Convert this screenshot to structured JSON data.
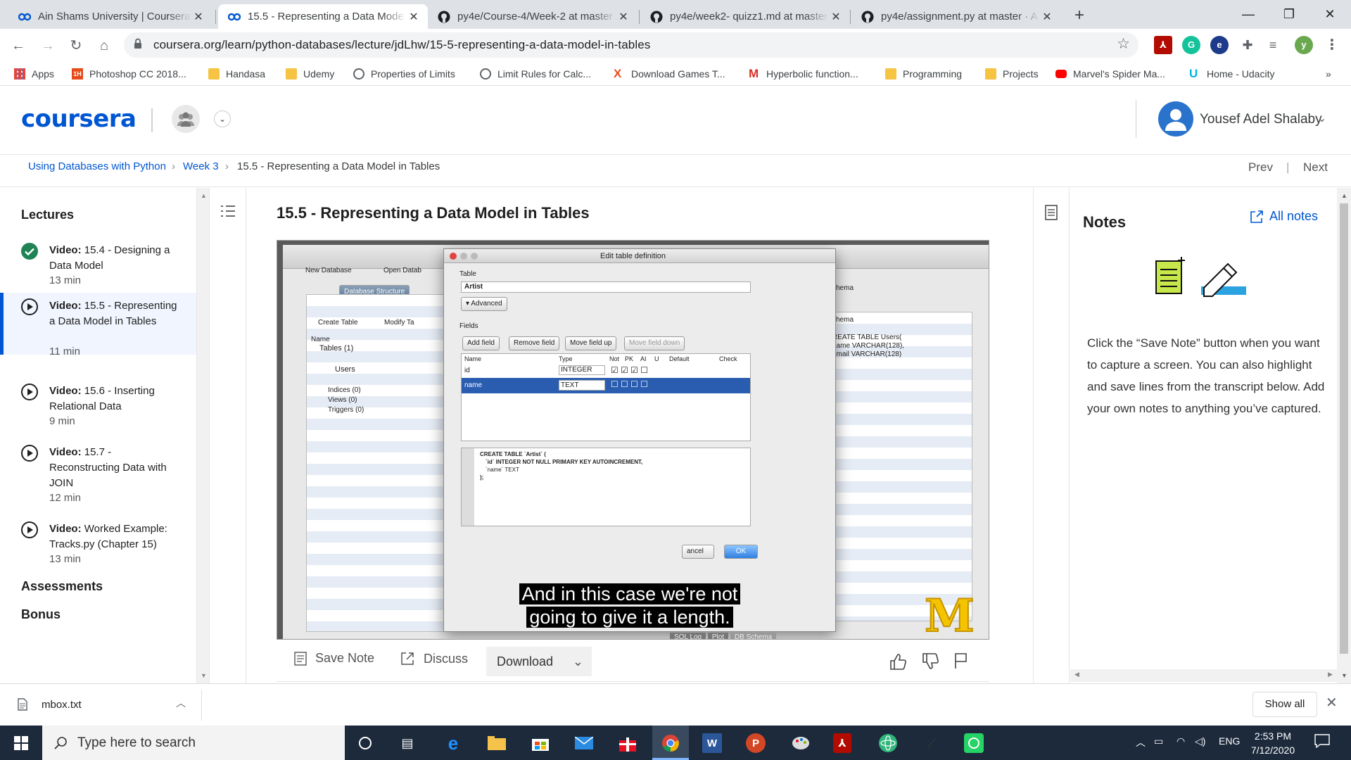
{
  "browser": {
    "tabs": [
      {
        "title": "Ain Shams University | Coursera",
        "favicon": "coursera-icon"
      },
      {
        "title": "15.5 - Representing a Data Mode",
        "favicon": "coursera-icon",
        "active": true
      },
      {
        "title": "py4e/Course-4/Week-2 at master",
        "favicon": "github-icon"
      },
      {
        "title": "py4e/week2- quizz1.md at master",
        "favicon": "github-icon"
      },
      {
        "title": "py4e/assignment.py at master · A",
        "favicon": "github-icon"
      }
    ],
    "url": "coursera.org/learn/python-databases/lecture/jdLhw/15-5-representing-a-data-model-in-tables",
    "profile_initial": "y",
    "bookmarks": [
      {
        "label": "Apps",
        "icon": "apps-grid-icon"
      },
      {
        "label": "Photoshop CC 2018...",
        "icon": "ih-icon"
      },
      {
        "label": "Handasa",
        "icon": "folder-icon"
      },
      {
        "label": "Udemy",
        "icon": "folder-icon"
      },
      {
        "label": "Properties of Limits",
        "icon": "globe-icon"
      },
      {
        "label": "Limit Rules for Calc...",
        "icon": "globe-icon"
      },
      {
        "label": "Download Games T...",
        "icon": "x-icon"
      },
      {
        "label": "Hyperbolic function...",
        "icon": "gmail-icon"
      },
      {
        "label": "Programming",
        "icon": "folder-icon"
      },
      {
        "label": "Projects",
        "icon": "folder-icon"
      },
      {
        "label": "Marvel's Spider Ma...",
        "icon": "youtube-icon"
      },
      {
        "label": "Home - Udacity",
        "icon": "udacity-icon"
      }
    ]
  },
  "header": {
    "logo": "coursera",
    "username": "Yousef Adel Shalaby"
  },
  "breadcrumb": {
    "items": [
      "Using Databases with Python",
      "Week 3",
      "15.5 - Representing a Data Model in Tables"
    ],
    "prev": "Prev",
    "next": "Next"
  },
  "sidebar": {
    "lectures_heading": "Lectures",
    "lectures": [
      {
        "kind": "Video:",
        "title": "15.4 - Designing a Data Model",
        "duration": "13 min",
        "status": "done"
      },
      {
        "kind": "Video:",
        "title": "15.5 - Representing a Data Model in Tables",
        "duration": "11 min",
        "status": "active"
      },
      {
        "kind": "Video:",
        "title": "15.6 - Inserting Relational Data",
        "duration": "9 min",
        "status": "todo"
      },
      {
        "kind": "Video:",
        "title": "15.7 - Reconstructing Data with JOIN",
        "duration": "12 min",
        "status": "todo"
      },
      {
        "kind": "Video:",
        "title": "Worked Example: Tracks.py (Chapter 15)",
        "duration": "13 min",
        "status": "todo"
      }
    ],
    "assessments": "Assessments",
    "bonus": "Bonus"
  },
  "main": {
    "title": "15.5 - Representing a Data Model in Tables",
    "video": {
      "dialog_title": "Edit table definition",
      "table_label": "Table",
      "table_name": "Artist",
      "advanced": "Advanced",
      "fields_label": "Fields",
      "buttons": [
        "Add field",
        "Remove field",
        "Move field up",
        "Move field down"
      ],
      "columns": [
        "Name",
        "Type",
        "Not",
        "PK",
        "AI",
        "U",
        "Default",
        "Check"
      ],
      "rows": [
        {
          "name": "id",
          "type": "INTEGER"
        },
        {
          "name": "name",
          "type": "TEXT"
        }
      ],
      "sql_lines": [
        "CREATE TABLE `Artist` (",
        "`id`   INTEGER NOT NULL PRIMARY KEY AUTOINCREMENT,",
        "`name`  TEXT",
        ");"
      ],
      "bg_toolbar": [
        "New Database",
        "Open Datab"
      ],
      "bg_tab": "Database Structure",
      "bg_actions": [
        "Create Table",
        "Modify Ta"
      ],
      "bg_tree": [
        "Name",
        "Tables (1)",
        "Users",
        "Indices (0)",
        "Views (0)",
        "Triggers (0)"
      ],
      "bg_schema": [
        "chema",
        "REATE TABLE Users(",
        "name VARCHAR(128),",
        "email VARCHAR(128)"
      ],
      "ok": "OK",
      "cancel": "ancel",
      "status_tabs": [
        "SQL Log",
        "Plot",
        "DB Schema"
      ],
      "caption_line1": "And in this case we're not",
      "caption_line2": "going to give it a length."
    },
    "actions": {
      "save_note": "Save Note",
      "discuss": "Discuss",
      "download": "Download"
    }
  },
  "notes": {
    "title": "Notes",
    "all_notes": "All notes",
    "body": "Click the “Save Note” button when you want to capture a screen. You can also highlight and save lines from the transcript below. Add your own notes to anything you’ve captured."
  },
  "download_shelf": {
    "file": "mbox.txt",
    "show_all": "Show all"
  },
  "taskbar": {
    "search_placeholder": "Type here to search",
    "language": "ENG",
    "time": "2:53 PM",
    "date": "7/12/2020"
  }
}
